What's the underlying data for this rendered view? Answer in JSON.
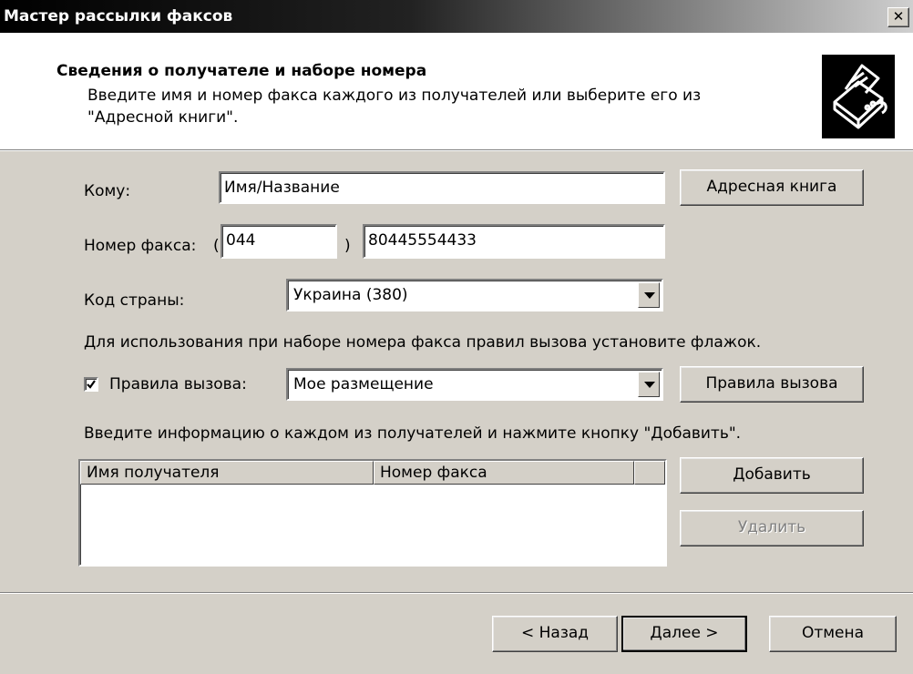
{
  "window": {
    "title": "Мастер рассылки факсов",
    "close_symbol": "✕"
  },
  "header": {
    "title": "Сведения о получателе и наборе номера",
    "description": "Введите имя и номер факса каждого из получателей или выберите его из \"Адресной книги\".",
    "icon": "fax-machine-icon"
  },
  "form": {
    "to_label": "Кому:",
    "to_value": "Имя/Название",
    "address_book_button": "Адресная книга",
    "fax_number_label": "Номер факса:",
    "paren_open": "(",
    "paren_close": ")",
    "area_code": "044",
    "fax_number": "80445554433",
    "country_label": "Код страны:",
    "country_value": "Украина (380)",
    "dialing_rules_hint": "Для использования при наборе номера факса правил вызова установите флажок.",
    "dialing_rules_checkbox_label": "Правила вызова:",
    "dialing_rules_checked": true,
    "location_value": "Мое размещение",
    "dialing_rules_button": "Правила вызова",
    "recipients_hint": "Введите информацию о каждом из получателей и нажмите кнопку \"Добавить\"."
  },
  "recipients_list": {
    "columns": [
      "Имя получателя",
      "Номер факса"
    ],
    "rows": []
  },
  "list_buttons": {
    "add": "Добавить",
    "remove": "Удалить"
  },
  "footer": {
    "back": "< Назад",
    "next": "Далее >",
    "cancel": "Отмена"
  }
}
